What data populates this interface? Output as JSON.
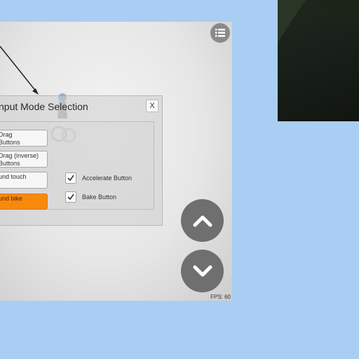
{
  "dialog": {
    "title": "nput Mode Selection",
    "close_label": "X"
  },
  "modes": [
    {
      "line1": "Drag",
      "line2": "Buttons",
      "active": false
    },
    {
      "line1": "Drag (inverse)",
      "line2": "Buttons",
      "active": false
    },
    {
      "line1": "und touch",
      "line2": "",
      "active": false
    },
    {
      "line1": "und bike",
      "line2": "",
      "active": true
    }
  ],
  "options": [
    {
      "label": "Accelerate Button",
      "checked": true
    },
    {
      "label": "Bake Button",
      "checked": true
    }
  ],
  "hud": {
    "fps": "FPS: 60"
  },
  "icons": {
    "menu": "list-icon",
    "up": "chevron-up-icon",
    "down": "chevron-down-icon",
    "check": "checkmark-icon"
  },
  "colors": {
    "background": "#aacdf3",
    "active_mode": "#f7890c",
    "round_button": "#6f6f6f"
  }
}
